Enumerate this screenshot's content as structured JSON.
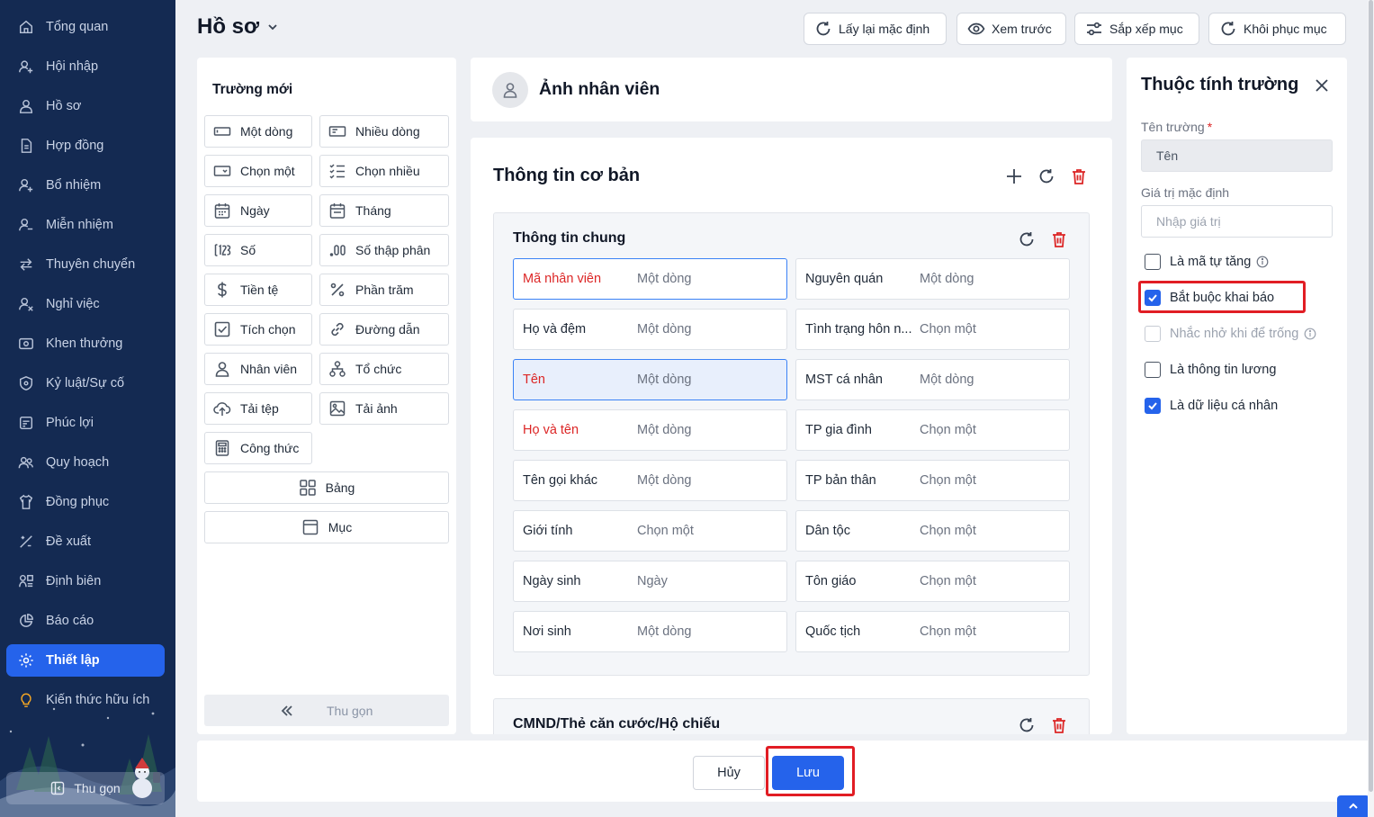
{
  "sidebar": {
    "items": [
      {
        "label": "Tổng quan",
        "icon": "home-icon"
      },
      {
        "label": "Hội nhập",
        "icon": "user-join-icon"
      },
      {
        "label": "Hồ sơ",
        "icon": "user-icon"
      },
      {
        "label": "Hợp đồng",
        "icon": "document-icon"
      },
      {
        "label": "Bổ nhiệm",
        "icon": "user-plus-icon"
      },
      {
        "label": "Miễn nhiệm",
        "icon": "user-minus-icon"
      },
      {
        "label": "Thuyên chuyển",
        "icon": "transfer-icon"
      },
      {
        "label": "Nghỉ việc",
        "icon": "user-leave-icon"
      },
      {
        "label": "Khen thưởng",
        "icon": "reward-icon"
      },
      {
        "label": "Kỷ luật/Sự cố",
        "icon": "shield-icon"
      },
      {
        "label": "Phúc lợi",
        "icon": "benefit-icon"
      },
      {
        "label": "Quy hoạch",
        "icon": "users-icon"
      },
      {
        "label": "Đồng phục",
        "icon": "shirt-icon"
      },
      {
        "label": "Đề xuất",
        "icon": "proposal-icon"
      },
      {
        "label": "Định biên",
        "icon": "org-icon"
      },
      {
        "label": "Báo cáo",
        "icon": "pie-chart-icon"
      },
      {
        "label": "Thiết lập",
        "icon": "gear-icon",
        "active": true
      },
      {
        "label": "Kiến thức hữu ích",
        "icon": "lightbulb-icon"
      }
    ],
    "collapse_label": "Thu gọn"
  },
  "header": {
    "title": "Hồ sơ",
    "buttons": [
      {
        "label": "Lấy lại mặc định",
        "icon": "refresh-icon"
      },
      {
        "label": "Xem trước",
        "icon": "eye-icon"
      },
      {
        "label": "Sắp xếp mục",
        "icon": "sliders-icon"
      },
      {
        "label": "Khôi phục mục",
        "icon": "restore-icon"
      }
    ]
  },
  "new_fields": {
    "title": "Trường mới",
    "types": [
      {
        "label": "Một dòng",
        "icon": "single-line-icon"
      },
      {
        "label": "Nhiều dòng",
        "icon": "multi-line-icon"
      },
      {
        "label": "Chọn một",
        "icon": "dropdown-icon"
      },
      {
        "label": "Chọn nhiều",
        "icon": "checklist-icon"
      },
      {
        "label": "Ngày",
        "icon": "calendar-icon"
      },
      {
        "label": "Tháng",
        "icon": "calendar-month-icon"
      },
      {
        "label": "Số",
        "icon": "number-icon"
      },
      {
        "label": "Số thập phân",
        "icon": "decimal-icon"
      },
      {
        "label": "Tiền tệ",
        "icon": "dollar-icon"
      },
      {
        "label": "Phần trăm",
        "icon": "percent-icon"
      },
      {
        "label": "Tích chọn",
        "icon": "checkbox-icon"
      },
      {
        "label": "Đường dẫn",
        "icon": "link-icon"
      },
      {
        "label": "Nhân viên",
        "icon": "person-icon"
      },
      {
        "label": "Tổ chức",
        "icon": "organization-icon"
      },
      {
        "label": "Tải tệp",
        "icon": "upload-icon"
      },
      {
        "label": "Tải ảnh",
        "icon": "image-icon"
      },
      {
        "label": "Công thức",
        "icon": "calculator-icon"
      },
      {
        "label": "Bảng",
        "icon": "grid-icon"
      },
      {
        "label": "Mục",
        "icon": "section-icon"
      }
    ],
    "collapse_label": "Thu gọn"
  },
  "photo_section": {
    "title": "Ảnh nhân viên"
  },
  "basic_section": {
    "title": "Thông tin cơ bản",
    "groups": [
      {
        "title": "Thông tin chung",
        "fields": [
          {
            "name": "Mã nhân viên",
            "type": "Một dòng",
            "required": true,
            "state": "highlight"
          },
          {
            "name": "Nguyên quán",
            "type": "Một dòng"
          },
          {
            "name": "Họ và đệm",
            "type": "Một dòng"
          },
          {
            "name": "Tình trạng hôn n...",
            "type": "Chọn một"
          },
          {
            "name": "Tên",
            "type": "Một dòng",
            "required": true,
            "state": "selected"
          },
          {
            "name": "MST cá nhân",
            "type": "Một dòng"
          },
          {
            "name": "Họ và tên",
            "type": "Một dòng",
            "required": true
          },
          {
            "name": "TP gia đình",
            "type": "Chọn một"
          },
          {
            "name": "Tên gọi khác",
            "type": "Một dòng"
          },
          {
            "name": "TP bản thân",
            "type": "Chọn một"
          },
          {
            "name": "Giới tính",
            "type": "Chọn một"
          },
          {
            "name": "Dân tộc",
            "type": "Chọn một"
          },
          {
            "name": "Ngày sinh",
            "type": "Ngày"
          },
          {
            "name": "Tôn giáo",
            "type": "Chọn một"
          },
          {
            "name": "Nơi sinh",
            "type": "Một dòng"
          },
          {
            "name": "Quốc tịch",
            "type": "Chọn một"
          }
        ]
      },
      {
        "title": "CMND/Thẻ căn cước/Hộ chiếu",
        "fields": []
      }
    ]
  },
  "properties": {
    "title": "Thuộc tính trường",
    "field_name_label": "Tên trường",
    "field_name_value": "Tên",
    "default_label": "Giá trị mặc định",
    "default_placeholder": "Nhập giá trị",
    "options": [
      {
        "label": "Là mã tự tăng",
        "checked": false,
        "disabled": false,
        "info": true
      },
      {
        "label": "Bắt buộc khai báo",
        "checked": true,
        "disabled": false,
        "info": false
      },
      {
        "label": "Nhắc nhở khi để trống",
        "checked": false,
        "disabled": true,
        "info": true
      },
      {
        "label": "Là thông tin lương",
        "checked": false,
        "disabled": false,
        "info": false
      },
      {
        "label": "Là dữ liệu cá nhân",
        "checked": true,
        "disabled": false,
        "info": false
      }
    ]
  },
  "footer": {
    "cancel_label": "Hủy",
    "save_label": "Lưu"
  },
  "colors": {
    "sidebar_bg": "#142a52",
    "accent": "#2563eb",
    "required": "#dc2626",
    "highlight_box": "#e11d24"
  }
}
